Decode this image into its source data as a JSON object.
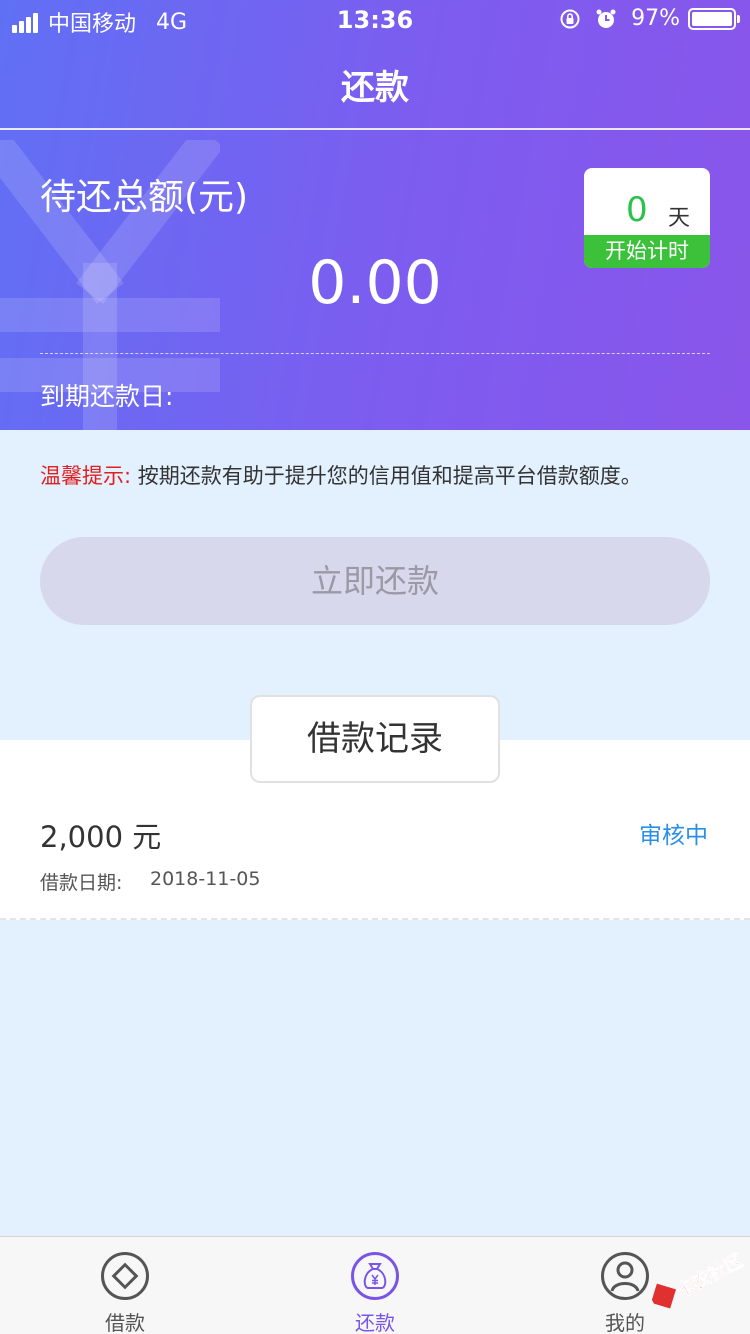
{
  "status_bar": {
    "carrier": "中国移动",
    "network": "4G",
    "time": "13:36",
    "battery": "97%"
  },
  "header": {
    "title": "还款"
  },
  "summary": {
    "total_label": "待还总额(元)",
    "total_value": "0.00",
    "due_label": "到期还款日:",
    "timer": {
      "days": "0",
      "unit": "天",
      "button": "开始计时"
    }
  },
  "tip": {
    "prefix": "温馨提示:",
    "text": "按期还款有助于提升您的信用值和提高平台借款额度。"
  },
  "repay_button": "立即还款",
  "records": {
    "tab_label": "借款记录",
    "items": [
      {
        "amount": "2,000 元",
        "status": "审核中",
        "date_label": "借款日期:",
        "date": "2018-11-05"
      }
    ]
  },
  "tabbar": {
    "items": [
      {
        "label": "借款",
        "icon": "diamond-icon",
        "active": false
      },
      {
        "label": "还款",
        "icon": "money-bag-icon",
        "active": true
      },
      {
        "label": "我的",
        "icon": "user-icon",
        "active": false
      }
    ]
  },
  "colors": {
    "accent": "#7a55e5",
    "status_blue": "#2a8fe6",
    "timer_green": "#3cc13b",
    "tip_red": "#e02020"
  },
  "watermark": {
    "text": "卡农社区"
  }
}
